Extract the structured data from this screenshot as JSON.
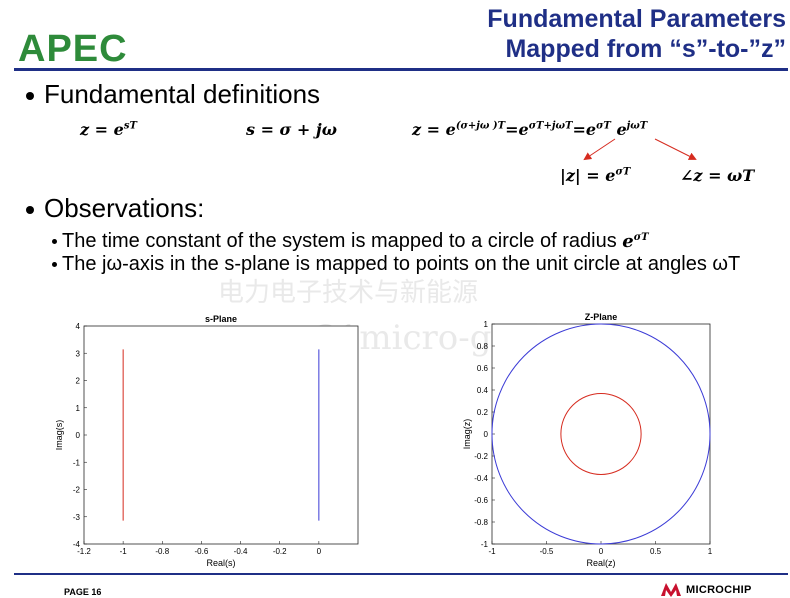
{
  "logo": {
    "text": "APEC",
    "color": "#2e8b3a"
  },
  "title": {
    "line1": "Fundamental Parameters",
    "line2": "Mapped from “s”-to-”z”",
    "color": "#1f2f86"
  },
  "bullets": {
    "definitions": "Fundamental definitions",
    "observations": "Observations:",
    "obs1": "The time constant of the system is mapped to a circle of radius",
    "obs1_math": "e",
    "obs1_math_sup": "σT",
    "obs2": "The jω-axis in the s-plane is mapped to points on the unit circle at angles ωT"
  },
  "equations": {
    "eq1": "z = e",
    "eq1_sup": "sT",
    "eq2": "s = σ + jω",
    "eq3_prefix": "z = e",
    "eq3_sup1": "(σ+jω )T",
    "eq3_mid1": "=e",
    "eq3_sup2": "σT+jωT",
    "eq3_mid2": "=e",
    "eq3_sup3": "σT",
    "eq3_mid3": " e",
    "eq3_sup4": "jωT",
    "mag": "|z| = e",
    "mag_sup": "σT",
    "angle": "∠z = ωT",
    "arrow_color": "#d62b1f"
  },
  "watermark": {
    "line1": "电力电子技术与新能源",
    "line2": "www.21micro-grid.cn"
  },
  "footer": {
    "page": "PAGE 16",
    "brand": "MICROCHIP",
    "brand_color": "#c8102e"
  },
  "chart_data": [
    {
      "type": "line",
      "title": "s-Plane",
      "xlabel": "Real(s)",
      "ylabel": "Imag(s)",
      "xlim": [
        -1.2,
        0.2
      ],
      "ylim": [
        -4,
        4
      ],
      "xticks": [
        -1.2,
        -1,
        -0.8,
        -0.6,
        -0.4,
        -0.2,
        0
      ],
      "yticks": [
        -4,
        -3,
        -2,
        -1,
        0,
        1,
        2,
        3,
        4
      ],
      "grid": false,
      "series": [
        {
          "color": "#d62b1f",
          "x": [
            -1,
            -1
          ],
          "y": [
            -3.14,
            3.14
          ]
        },
        {
          "color": "#3b3bd6",
          "x": [
            0,
            0
          ],
          "y": [
            -3.14,
            3.14
          ]
        }
      ]
    },
    {
      "type": "line",
      "title": "Z-Plane",
      "xlabel": "Real(z)",
      "ylabel": "Imag(z)",
      "xlim": [
        -1,
        1
      ],
      "ylim": [
        -1,
        1
      ],
      "xticks": [
        -1,
        -0.5,
        0,
        0.5,
        1
      ],
      "yticks": [
        -1,
        -0.8,
        -0.6,
        -0.4,
        -0.2,
        0,
        0.2,
        0.4,
        0.6,
        0.8,
        1
      ],
      "grid": false,
      "series": [
        {
          "color": "#3b3bd6",
          "shape": "circle",
          "center": [
            0,
            0
          ],
          "radius": 1
        },
        {
          "color": "#d62b1f",
          "shape": "circle",
          "center": [
            0,
            0
          ],
          "radius": 0.368
        }
      ]
    }
  ]
}
